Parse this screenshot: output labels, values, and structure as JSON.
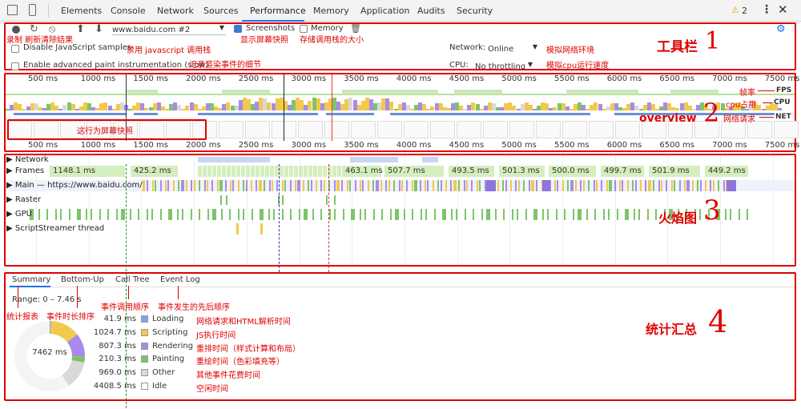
{
  "devtools_tabs": [
    "Elements",
    "Console",
    "Network",
    "Sources",
    "Performance",
    "Memory",
    "Application",
    "Audits",
    "Security"
  ],
  "active_tab": "Performance",
  "warnings_count": "2",
  "toolbar": {
    "profile_select": "www.baidu.com #2",
    "screenshots_label": "Screenshots",
    "memory_label": "Memory",
    "disable_js_label": "Disable JavaScript samples",
    "advanced_paint_label": "Enable advanced paint instrumentation (slow)",
    "network_label": "Network:",
    "network_value": "Online",
    "cpu_label": "CPU:",
    "cpu_value": "No throttling"
  },
  "annotations": {
    "record_reload_clear": "录制 刷新清除结果",
    "disable_js_note": "禁用 javascript 调用栈",
    "paint_note": "记录渲染事件的细节",
    "screenshots_note": "显示屏幕快照",
    "memory_note": "存储调用栈的大小",
    "network_note": "模拟网络环境",
    "cpu_note": "模拟cpu运行速度",
    "toolbar_title": "工具栏",
    "toolbar_number": "1",
    "fps_note": "帧率",
    "cpu_usage_note": "cpu占用",
    "net_note": "网络请求",
    "overview_title": "overview",
    "overview_number": "2",
    "screenshot_row_note": "这行为屏幕快照",
    "flame_title": "火焰图",
    "flame_number": "3",
    "summary_tab_note": "统计报表",
    "bottomup_tab_note": "事件时长排序",
    "calltree_tab_note": "事件调用顺序",
    "eventlog_tab_note": "事件发生的先后顺序",
    "stats_title": "统计汇总",
    "stats_number": "4"
  },
  "overview_labels": {
    "fps": "FPS",
    "cpu": "CPU",
    "net": "NET"
  },
  "ruler_ticks": [
    "500 ms",
    "1000 ms",
    "1500 ms",
    "2000 ms",
    "2500 ms",
    "3000 ms",
    "3500 ms",
    "4000 ms",
    "4500 ms",
    "5000 ms",
    "5500 ms",
    "6000 ms",
    "6500 ms",
    "7000 ms",
    "7500 ms"
  ],
  "tracks": {
    "network": "Network",
    "frames": "Frames",
    "main": "Main — https://www.baidu.com/",
    "raster": "Raster",
    "gpu": "GPU",
    "scriptstreamer": "ScriptStreamer thread"
  },
  "frame_times": [
    "1148.1 ms",
    "425.2 ms",
    "463.1 ms",
    "507.7 ms",
    "493.5 ms",
    "501.3 ms",
    "500.0 ms",
    "499.7 ms",
    "501.9 ms",
    "449.2 ms"
  ],
  "bottom_tabs": [
    "Summary",
    "Bottom-Up",
    "Call Tree",
    "Event Log"
  ],
  "range": "Range: 0 – 7.46 s",
  "donut_total": "7462 ms",
  "summary": [
    {
      "ms": "41.9 ms",
      "label": "Loading",
      "color": "#7aa6e8",
      "note": "网络请求和HTML解析时间",
      "frac": 0.0056
    },
    {
      "ms": "1024.7 ms",
      "label": "Scripting",
      "color": "#f2c94c",
      "note": "JS执行时间",
      "frac": 0.1373
    },
    {
      "ms": "807.3 ms",
      "label": "Rendering",
      "color": "#a88be8",
      "note": "重排时间（样式计算和布局）",
      "frac": 0.1082
    },
    {
      "ms": "210.3 ms",
      "label": "Painting",
      "color": "#7dc46a",
      "note": "重绘时间（色彩填充等）",
      "frac": 0.0282
    },
    {
      "ms": "969.0 ms",
      "label": "Other",
      "color": "#d9d9d9",
      "note": "其他事件花费时间",
      "frac": 0.1299
    },
    {
      "ms": "4408.5 ms",
      "label": "Idle",
      "color": "#ffffff",
      "note": "空闲时间",
      "frac": 0.5908
    }
  ]
}
